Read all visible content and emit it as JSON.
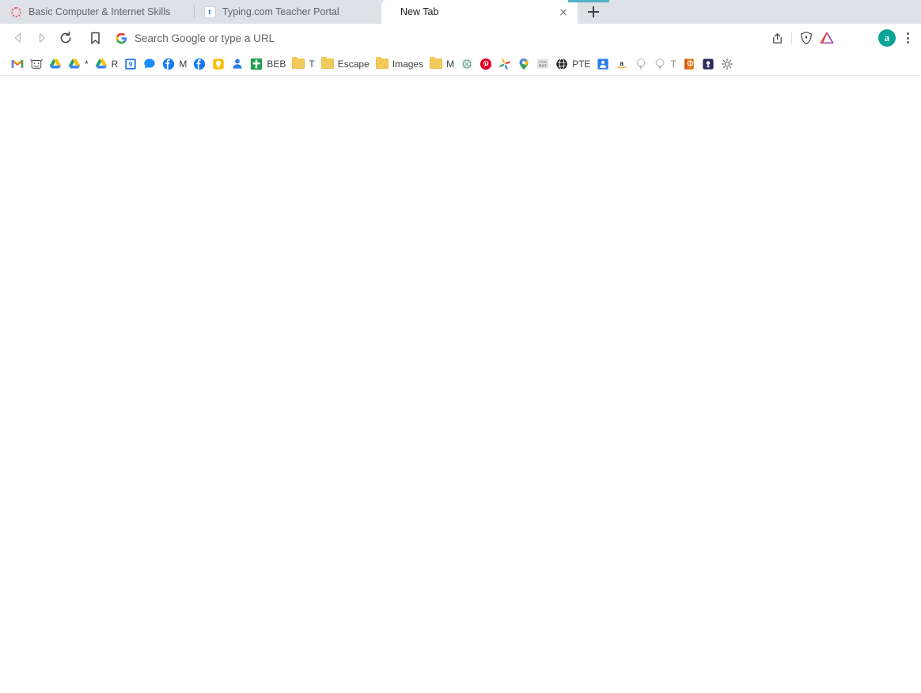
{
  "browser": {
    "name": "Brave",
    "accent_color": "#4fb3c4"
  },
  "tabs": [
    {
      "title": "Basic Computer & Internet Skills",
      "favicon": "dashed-ring-icon",
      "active": false
    },
    {
      "title": "Typing.com Teacher Portal",
      "favicon": "typing-t-icon",
      "active": false
    },
    {
      "title": "New Tab",
      "favicon": "none",
      "active": true
    }
  ],
  "tab_controls": {
    "close_label": "Close tab",
    "new_tab_label": "New tab"
  },
  "toolbar": {
    "back_label": "Back",
    "forward_label": "Forward",
    "reload_label": "Reload",
    "bookmark_label": "Bookmark this tab",
    "share_label": "Share",
    "shields_label": "Brave Shields",
    "rewards_label": "Brave Rewards",
    "profile_initial": "a",
    "menu_label": "Customize and control Brave"
  },
  "omnibox": {
    "value": "",
    "placeholder": "Search Google or type a URL",
    "search_engine_icon": "google-g-icon"
  },
  "bookmarks": [
    {
      "label": "",
      "icon": "gmail-icon",
      "color": "#ea4335"
    },
    {
      "label": "",
      "icon": "cow-icon",
      "color": "#3c4043"
    },
    {
      "label": "",
      "icon": "google-drive-icon",
      "color": "#1fa463"
    },
    {
      "label": "",
      "icon": "google-drive-icon",
      "color": "#1fa463"
    },
    {
      "label": "*",
      "icon": "asterisk-icon",
      "color": "#5f6368"
    },
    {
      "label": "R",
      "icon": "google-drive-icon",
      "color": "#1fa463"
    },
    {
      "label": "",
      "icon": "google-calendar-icon",
      "color": "#1a73e8"
    },
    {
      "label": "",
      "icon": "messages-bubble-icon",
      "color": "#1a8cff"
    },
    {
      "label": "M",
      "icon": "facebook-icon",
      "color": "#1877f2"
    },
    {
      "label": "",
      "icon": "facebook-icon",
      "color": "#1877f2"
    },
    {
      "label": "",
      "icon": "keep-bulb-icon",
      "color": "#fbbc04"
    },
    {
      "label": "",
      "icon": "person-icon",
      "color": "#1a73e8"
    },
    {
      "label": "BEB",
      "icon": "green-cross-icon",
      "color": "#1e9e53"
    },
    {
      "label": "T",
      "icon": "folder-icon",
      "color": "#f2ca5c"
    },
    {
      "label": "Escape",
      "icon": "folder-icon",
      "color": "#f2ca5c"
    },
    {
      "label": "Images",
      "icon": "folder-icon",
      "color": "#f2ca5c"
    },
    {
      "label": "M",
      "icon": "folder-icon",
      "color": "#f2ca5c"
    },
    {
      "label": "",
      "icon": "chatgpt-icon",
      "color": "#74aa9c"
    },
    {
      "label": "",
      "icon": "pinterest-icon",
      "color": "#e60023"
    },
    {
      "label": "",
      "icon": "google-photos-icon",
      "color": "#fbbc04"
    },
    {
      "label": "",
      "icon": "google-maps-pin-icon",
      "color": "#34a853"
    },
    {
      "label": "",
      "icon": "eat-icon",
      "color": "#9aa0a6"
    },
    {
      "label": "PTE",
      "icon": "globe-icon",
      "color": "#202124"
    },
    {
      "label": "",
      "icon": "pdf-person-icon",
      "color": "#1a73e8"
    },
    {
      "label": "",
      "icon": "amazon-icon",
      "color": "#ff9900"
    },
    {
      "label": "",
      "icon": "tree-icon",
      "color": "#a8b5a0"
    },
    {
      "label": "T",
      "icon": "tree-icon",
      "color": "#a8b5a0"
    },
    {
      "label": "",
      "icon": "orange-book-icon",
      "color": "#e8711a"
    },
    {
      "label": "",
      "icon": "dark-badge-icon",
      "color": "#2b2d5e"
    },
    {
      "label": "",
      "icon": "gear-icon",
      "color": "#5f6368"
    }
  ],
  "page": {
    "content": ""
  }
}
